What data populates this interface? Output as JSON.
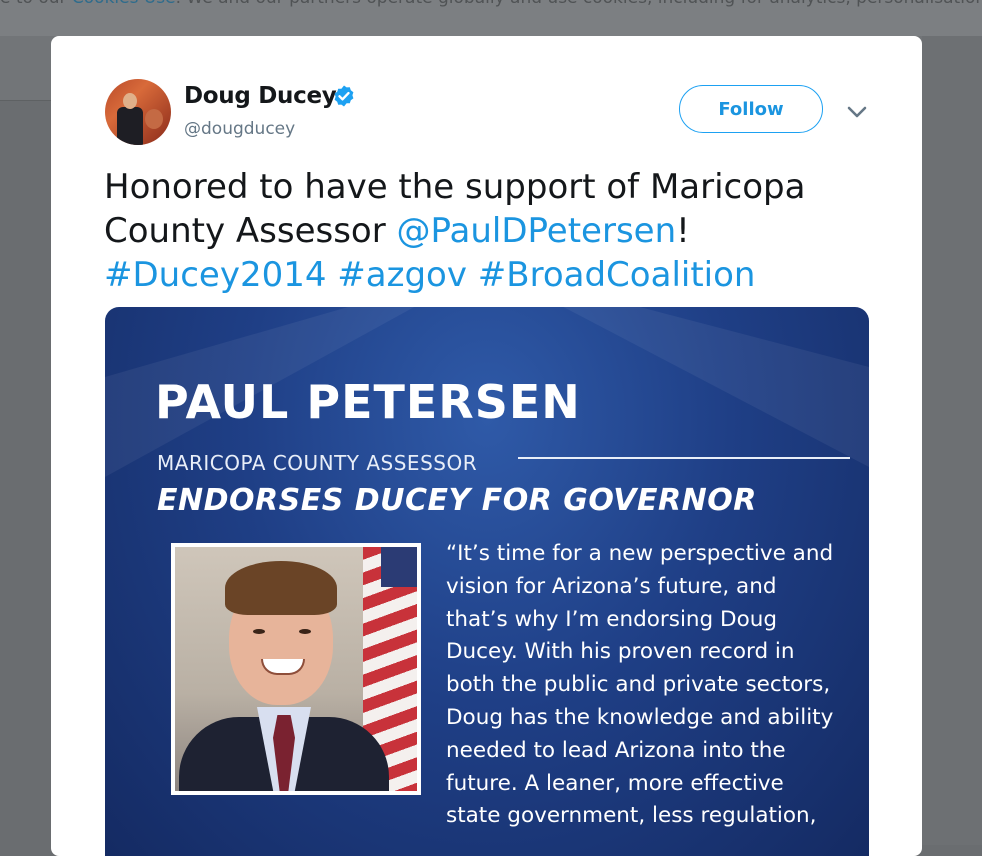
{
  "cookie_bar": {
    "text_before": "e to our ",
    "link_text": "Cookies Use",
    "text_after": ". We and our partners operate globally and use cookies, including for analytics, personalisation, a"
  },
  "tweet": {
    "author_name": "Doug Ducey",
    "author_handle": "@dougducey",
    "verified": true,
    "follow_label": "Follow",
    "text_part1": "Honored to have the support of Maricopa County Assessor ",
    "mention": "@PaulDPetersen",
    "text_part2": "!",
    "hashtags": [
      "#Ducey2014",
      "#azgov",
      "#BroadCoalition"
    ],
    "icons": {
      "verified": "verified-badge-icon",
      "more": "chevron-down-icon"
    },
    "colors": {
      "link": "#1b95e0",
      "follow_border": "#1da1f2",
      "text": "#14171a",
      "muted": "#657786"
    }
  },
  "media": {
    "title": "PAUL PETERSEN",
    "subtitle": "MARICOPA COUNTY ASSESSOR",
    "headline": "ENDORSES DUCEY FOR GOVERNOR",
    "quote_lines": [
      "“It’s time for a new perspective and",
      "vision for Arizona’s future, and",
      "that’s why I’m endorsing Doug",
      "Ducey. With his proven record in",
      "both the public and private sectors,",
      "Doug has the knowledge and ability",
      "needed to lead Arizona into the",
      "future. A leaner, more effective",
      "state government, less regulation,"
    ],
    "background_color": "#1f3f86"
  }
}
